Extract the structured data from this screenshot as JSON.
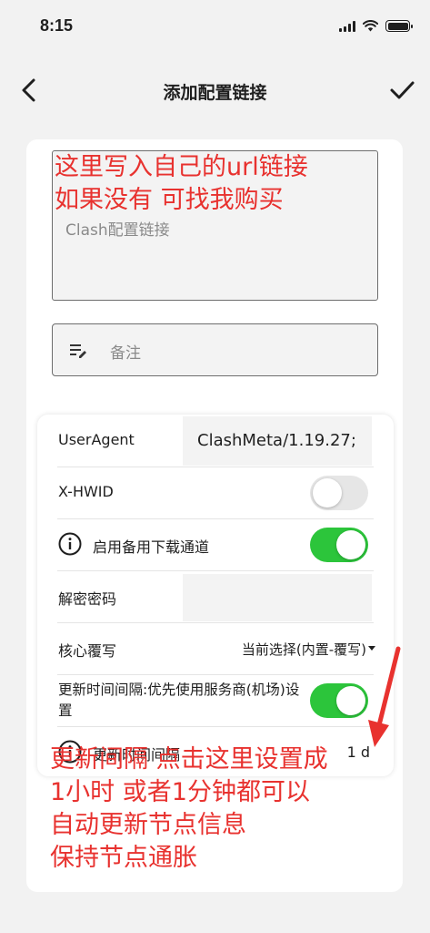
{
  "status_bar": {
    "time": "8:15",
    "icons": [
      "signal-icon",
      "wifi-icon",
      "battery-icon"
    ]
  },
  "header": {
    "title": "添加配置链接",
    "back_icon": "chevron-left-icon",
    "confirm_icon": "check-icon"
  },
  "url_input": {
    "placeholder": "Clash配置链接",
    "value": ""
  },
  "remark_input": {
    "placeholder": "备注",
    "icon": "edit-note-icon",
    "value": ""
  },
  "settings": {
    "user_agent": {
      "label": "UserAgent",
      "value": "ClashMeta/1.19.27;"
    },
    "hwid": {
      "label": "X-HWID",
      "enabled": false
    },
    "backup_channel": {
      "label": "启用备用下载通道",
      "icon": "info-icon",
      "enabled": true
    },
    "decrypt_password": {
      "label": "解密密码",
      "value": ""
    },
    "core_override": {
      "label": "核心覆写",
      "value": "当前选择(内置-覆写)",
      "icon": "caret-down-icon"
    },
    "provider_interval": {
      "label": "更新时间间隔:优先使用服务商(机场)设置",
      "enabled": true
    },
    "update_interval": {
      "label": "更新时间间隔",
      "icon": "info-icon",
      "value": "1 d"
    }
  },
  "annotations": {
    "top": [
      "这里写入自己的url链接",
      "如果没有 可找我购买"
    ],
    "bottom": [
      "更新间隔  点击这里设置成",
      "1小时 或者1分钟都可以",
      "自动更新节点信息",
      "保持节点通胀"
    ]
  },
  "colors": {
    "toggle_on": "#2cc53b",
    "toggle_off": "#e6e6e6",
    "annotation": "#e8322f",
    "background": "#f2f2f2"
  }
}
